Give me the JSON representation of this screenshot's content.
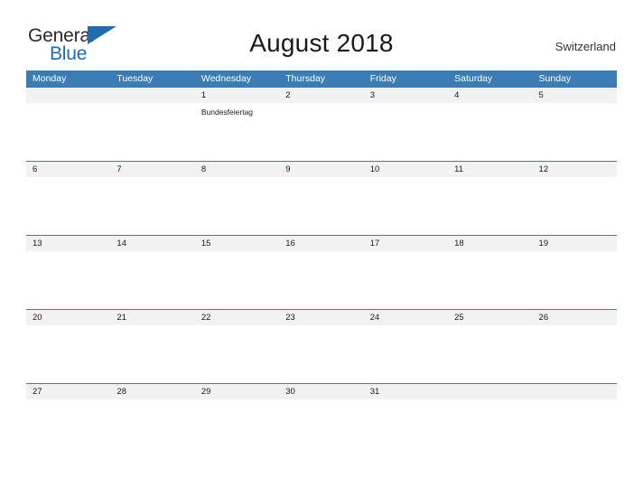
{
  "brand": {
    "name_top": "General",
    "name_bottom": "Blue",
    "flag_color": "#1f6cb0",
    "text_color": "#2b2b2b"
  },
  "header": {
    "title": "August 2018",
    "region": "Switzerland"
  },
  "theme": {
    "header_blue": "#3b7cb5",
    "band_gray": "#f2f2f2",
    "rule_blue": "#3b7cb5",
    "page_background": "#ffffff"
  },
  "calendar": {
    "weekdays": [
      "Monday",
      "Tuesday",
      "Wednesday",
      "Thursday",
      "Friday",
      "Saturday",
      "Sunday"
    ],
    "weeks": [
      [
        {
          "day": "",
          "event": ""
        },
        {
          "day": "",
          "event": ""
        },
        {
          "day": "1",
          "event": "Bundesfeiertag"
        },
        {
          "day": "2",
          "event": ""
        },
        {
          "day": "3",
          "event": ""
        },
        {
          "day": "4",
          "event": ""
        },
        {
          "day": "5",
          "event": ""
        }
      ],
      [
        {
          "day": "6",
          "event": ""
        },
        {
          "day": "7",
          "event": ""
        },
        {
          "day": "8",
          "event": ""
        },
        {
          "day": "9",
          "event": ""
        },
        {
          "day": "10",
          "event": ""
        },
        {
          "day": "11",
          "event": ""
        },
        {
          "day": "12",
          "event": ""
        }
      ],
      [
        {
          "day": "13",
          "event": ""
        },
        {
          "day": "14",
          "event": ""
        },
        {
          "day": "15",
          "event": ""
        },
        {
          "day": "16",
          "event": ""
        },
        {
          "day": "17",
          "event": ""
        },
        {
          "day": "18",
          "event": ""
        },
        {
          "day": "19",
          "event": ""
        }
      ],
      [
        {
          "day": "20",
          "event": ""
        },
        {
          "day": "21",
          "event": ""
        },
        {
          "day": "22",
          "event": ""
        },
        {
          "day": "23",
          "event": ""
        },
        {
          "day": "24",
          "event": ""
        },
        {
          "day": "25",
          "event": ""
        },
        {
          "day": "26",
          "event": ""
        }
      ],
      [
        {
          "day": "27",
          "event": ""
        },
        {
          "day": "28",
          "event": ""
        },
        {
          "day": "29",
          "event": ""
        },
        {
          "day": "30",
          "event": ""
        },
        {
          "day": "31",
          "event": ""
        },
        {
          "day": "",
          "event": ""
        },
        {
          "day": "",
          "event": ""
        }
      ]
    ]
  }
}
